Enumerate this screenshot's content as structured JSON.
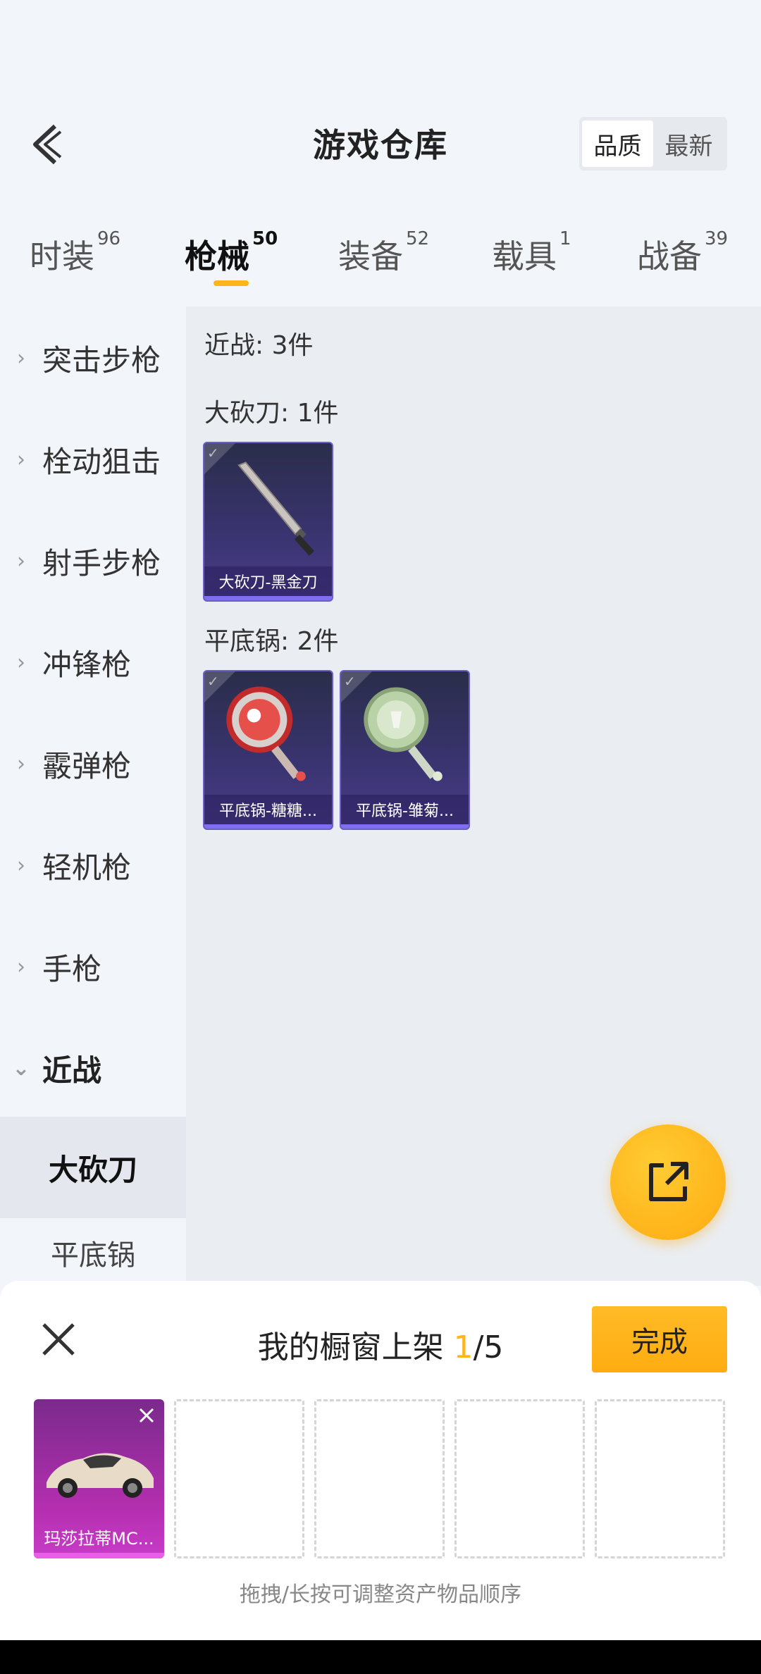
{
  "header": {
    "title": "游戏仓库",
    "sort_options": [
      "品质",
      "最新"
    ]
  },
  "tabs": [
    {
      "label": "时装",
      "count": "96"
    },
    {
      "label": "枪械",
      "count": "50"
    },
    {
      "label": "装备",
      "count": "52"
    },
    {
      "label": "载具",
      "count": "1"
    },
    {
      "label": "战备",
      "count": "39"
    }
  ],
  "sidebar": {
    "items": [
      "突击步枪",
      "栓动狙击",
      "射手步枪",
      "冲锋枪",
      "霰弹枪",
      "轻机枪",
      "手枪",
      "近战"
    ],
    "sub_items": [
      "大砍刀",
      "平底锅"
    ]
  },
  "content": {
    "category_count": "近战: 3件",
    "groups": [
      {
        "label": "大砍刀: 1件",
        "items": [
          "大砍刀-黑金刀"
        ]
      },
      {
        "label": "平底锅: 2件",
        "items": [
          "平底锅-糖糖...",
          "平底锅-雏菊..."
        ]
      }
    ]
  },
  "showcase": {
    "title_prefix": "我的橱窗上架 ",
    "filled": "1",
    "total": "/5",
    "done_label": "完成",
    "slot_item": "玛莎拉蒂MC...",
    "hint": "拖拽/长按可调整资产物品顺序"
  },
  "colors": {
    "accent": "#ffb51a",
    "card_purple": "#3a3471",
    "legendary_magenta": "#b52fb0"
  }
}
